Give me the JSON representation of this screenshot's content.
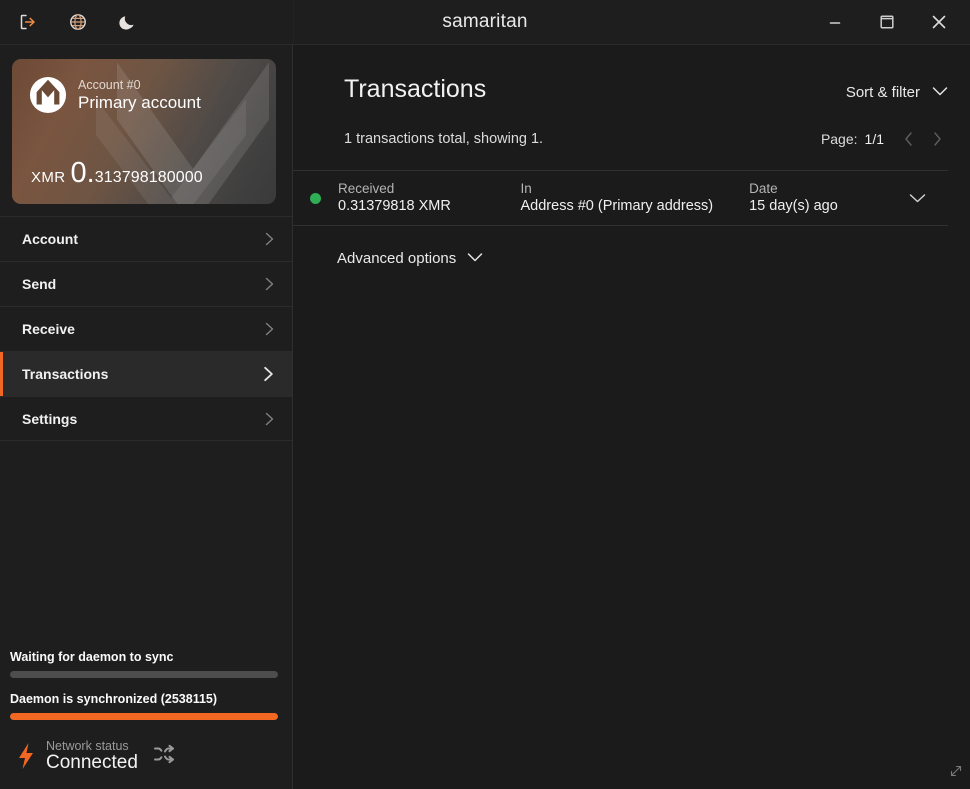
{
  "window": {
    "title": "samaritan",
    "toolbar_icons": [
      {
        "name": "logout-icon",
        "label": "Log out"
      },
      {
        "name": "globe-icon",
        "label": "Language"
      },
      {
        "name": "moon-icon",
        "label": "Dark mode"
      }
    ],
    "controls": [
      {
        "name": "minimize-button",
        "label": "Minimize"
      },
      {
        "name": "maximize-button",
        "label": "Maximize"
      },
      {
        "name": "close-button",
        "label": "Close"
      }
    ]
  },
  "sidebar": {
    "account_card": {
      "account_number": "Account #0",
      "account_name": "Primary account",
      "currency": "XMR",
      "balance_integer": "0.",
      "balance_fraction": "313798180000",
      "logo_icon": "monero-logo-icon"
    },
    "nav_items": [
      {
        "label": "Account",
        "active": false
      },
      {
        "label": "Send",
        "active": false
      },
      {
        "label": "Receive",
        "active": false
      },
      {
        "label": "Transactions",
        "active": true
      },
      {
        "label": "Settings",
        "active": false
      }
    ],
    "status": {
      "wallet_sync_label": "Waiting for daemon to sync",
      "wallet_sync_percent": 0,
      "daemon_sync_label": "Daemon is synchronized (2538115)",
      "daemon_sync_percent": 100,
      "network_title": "Network status",
      "network_value": "Connected",
      "bolt_icon": "lightning-bolt-icon",
      "shuffle_icon": "shuffle-icon"
    }
  },
  "main": {
    "page_title": "Transactions",
    "sort_filter_label": "Sort & filter",
    "total_text": "1 transactions total, showing 1.",
    "pager": {
      "label": "Page:",
      "value": "1/1",
      "prev_label": "Previous page",
      "next_label": "Next page"
    },
    "transactions": [
      {
        "status_color": "#2fae55",
        "type_head": "Received",
        "type_value": "0.31379818 XMR",
        "direction_head": "In",
        "direction_value": "Address #0 (Primary address)",
        "date_head": "Date",
        "date_value": "15 day(s) ago"
      }
    ],
    "advanced_options_label": "Advanced options"
  },
  "colors": {
    "accent": "#f26822",
    "success": "#2fae55",
    "background": "#1b1b1b",
    "panel": "#1e1e1e"
  }
}
